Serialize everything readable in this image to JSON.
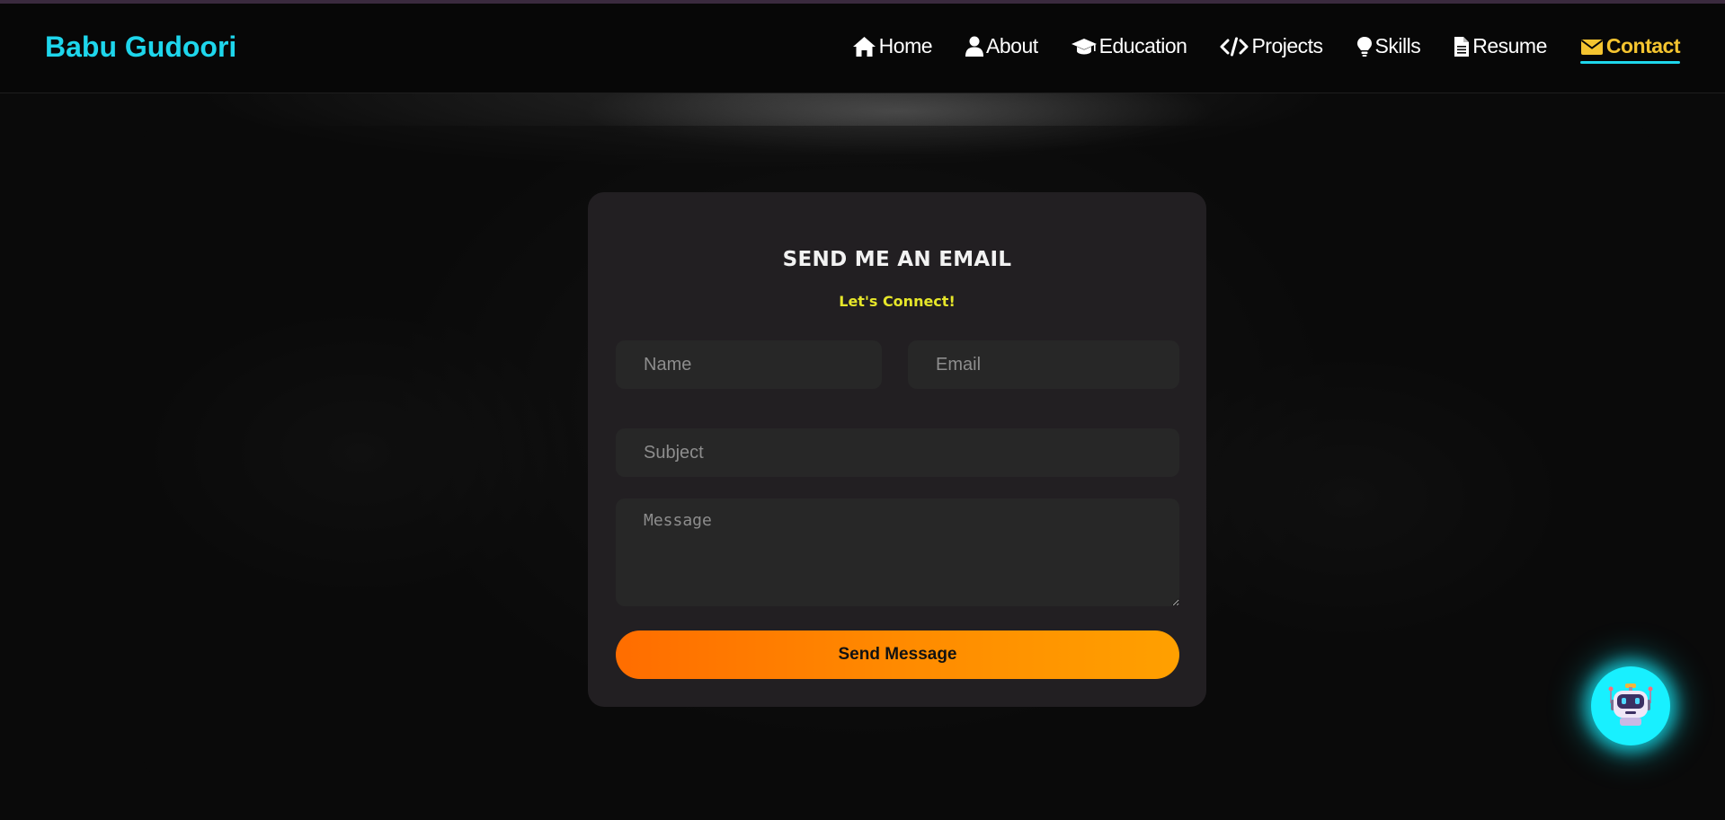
{
  "brand": {
    "name": "Babu Gudoori"
  },
  "nav": {
    "items": [
      {
        "label": "Home",
        "icon": "home-icon"
      },
      {
        "label": "About",
        "icon": "user-icon"
      },
      {
        "label": "Education",
        "icon": "graduation-cap-icon"
      },
      {
        "label": "Projects",
        "icon": "code-icon"
      },
      {
        "label": "Skills",
        "icon": "lightbulb-icon"
      },
      {
        "label": "Resume",
        "icon": "document-icon"
      },
      {
        "label": "Contact",
        "icon": "envelope-icon",
        "active": true
      }
    ]
  },
  "form": {
    "title": "SEND ME AN EMAIL",
    "subtitle": "Let's Connect!",
    "name_placeholder": "Name",
    "email_placeholder": "Email",
    "subject_placeholder": "Subject",
    "message_placeholder": "Message",
    "submit_label": "Send Message"
  },
  "chatbot": {
    "icon": "robot-icon"
  },
  "colors": {
    "brand": "#1ed6ec",
    "active_nav": "#f4c430",
    "subtitle": "#e6e62a",
    "button_start": "#ff6d00",
    "button_end": "#ffa000",
    "chatbot_glow": "#18f0ff"
  }
}
